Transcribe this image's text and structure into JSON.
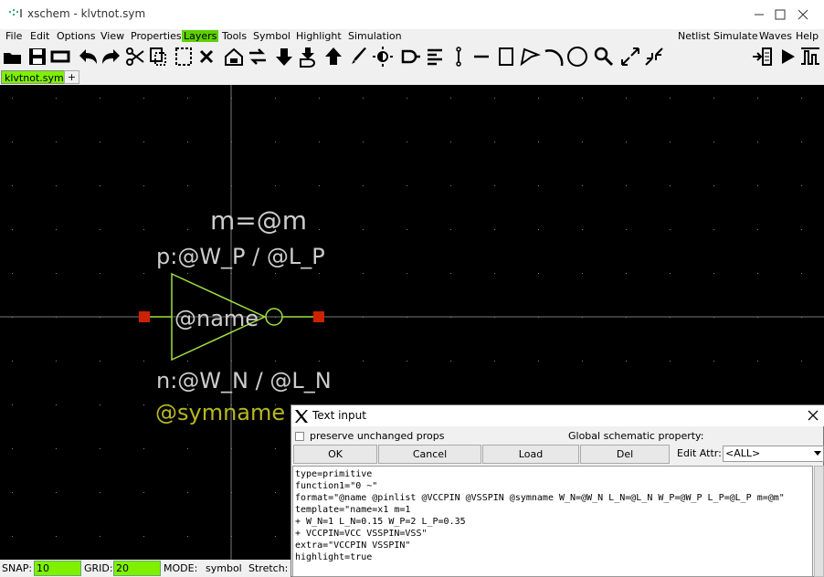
{
  "window": {
    "title": "xschem - klvtnot.sym"
  },
  "menubar": {
    "items": [
      "File",
      "Edit",
      "Options",
      "View",
      "Properties",
      "Layers",
      "Tools",
      "Symbol",
      "Highlight",
      "Simulation"
    ],
    "right_items": [
      "Netlist",
      "Simulate",
      "Waves",
      "Help"
    ],
    "active": "Layers"
  },
  "toolbar": {
    "icons": [
      "open-icon",
      "save-icon",
      "reload-icon",
      "undo-icon",
      "redo-icon",
      "cut-icon",
      "copy-icon",
      "move-icon",
      "delete-icon",
      "push-icon",
      "swap-icon",
      "descend-icon",
      "descend-symbol-icon",
      "ascend-icon",
      "pen-icon",
      "highlight-icon",
      "gate-icon",
      "list-icon",
      "pin-icon",
      "line-icon",
      "rect-icon",
      "polygon-icon",
      "arc-icon",
      "circle-icon",
      "zoom-icon",
      "zoom-full-icon",
      "zoom-fit-icon"
    ],
    "right_icons": [
      "netlist-icon",
      "simulate-icon",
      "waves-icon"
    ]
  },
  "tabs": {
    "current": "klvtnot.sym",
    "add_label": "+"
  },
  "canvas": {
    "label_m": "m=@m",
    "label_p": "p:@W_P / @L_P",
    "label_name": "@name",
    "label_n": "n:@W_N / @L_N",
    "label_symname": "@symname",
    "colors": {
      "background": "#000000",
      "symbol": "#a0e040",
      "text": "#cccccc",
      "symname": "#b8b820",
      "pin": "#cc2200",
      "axis": "#777777",
      "grid_dot": "#888888"
    }
  },
  "statusbar": {
    "snap_label": "SNAP:",
    "snap_value": "10",
    "grid_label": "GRID:",
    "grid_value": "20",
    "mode_label": "MODE:",
    "mode_value": "symbol",
    "stretch_label": "Stretch:"
  },
  "dialog": {
    "title": "Text input",
    "preserve_label": "preserve unchanged props",
    "global_label": "Global schematic property:",
    "buttons": {
      "ok": "OK",
      "cancel": "Cancel",
      "load": "Load",
      "del": "Del"
    },
    "edit_attr_label": "Edit Attr:",
    "edit_attr_value": "<ALL>",
    "text": "type=primitive\nfunction1=\"0 ~\"\nformat=\"@name @pinlist @VCCPIN @VSSPIN @symname W_N=@W_N L_N=@L_N W_P=@W_P L_P=@L_P m=@m\"\ntemplate=\"name=x1 m=1\n+ W_N=1 L_N=0.15 W_P=2 L_P=0.35\n+ VCCPIN=VCC VSSPIN=VSS\"\nextra=\"VCCPIN VSSPIN\"\nhighlight=true"
  }
}
